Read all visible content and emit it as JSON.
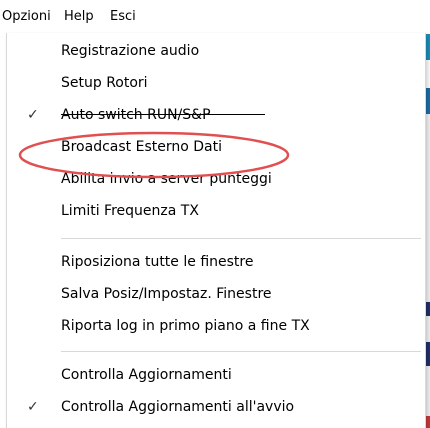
{
  "menubar": {
    "opzioni": "Opzioni",
    "help": "Help",
    "esci": "Esci"
  },
  "menu": {
    "items": [
      {
        "label": "Registrazione audio",
        "checked": false
      },
      {
        "label": "Setup Rotori",
        "checked": false
      },
      {
        "label": "Auto switch RUN/S&P",
        "checked": true
      },
      {
        "label": "Broadcast Esterno Dati",
        "checked": false
      },
      {
        "label": "Abilita invio a server punteggi",
        "checked": false
      },
      {
        "label": "Limiti Frequenza TX",
        "checked": false
      },
      {
        "label": "Riposiziona tutte le finestre",
        "checked": false
      },
      {
        "label": "Salva Posiz/Impostaz. Finestre",
        "checked": false
      },
      {
        "label": "Riporta log in primo piano a fine TX",
        "checked": false
      },
      {
        "label": "Controlla Aggiornamenti",
        "checked": false
      },
      {
        "label": "Controlla Aggiornamenti all'avvio",
        "checked": true
      }
    ],
    "check_glyph": "✓"
  },
  "highlight": {
    "annotation_color": "#e05050",
    "annotation_target": "Broadcast Esterno Dati"
  }
}
